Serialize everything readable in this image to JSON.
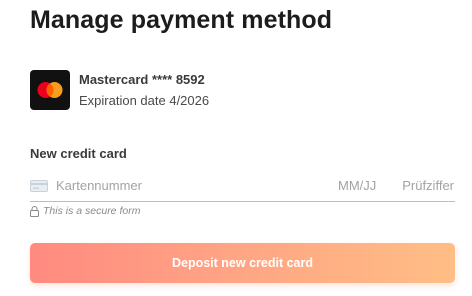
{
  "header": {
    "title": "Manage payment method"
  },
  "saved_card": {
    "name": "Mastercard **** 8592",
    "expiration": "Expiration date 4/2026",
    "logo_icon": "mastercard-logo-icon"
  },
  "new_card": {
    "section_label": "New credit card",
    "card_icon": "credit-card-icon",
    "card_number_placeholder": "Kartennummer",
    "expiry_placeholder": "MM/JJ",
    "cvc_placeholder": "Prüfziffer",
    "secure_icon": "lock-icon",
    "secure_note": "This is a secure form"
  },
  "actions": {
    "deposit_label": "Deposit new credit card"
  },
  "colors": {
    "button_gradient_start": "#ff8a80",
    "button_gradient_end": "#ffbe85",
    "mastercard_red": "#eb001b",
    "mastercard_orange": "#f79e1b",
    "mastercard_overlap": "#ff5f00"
  }
}
